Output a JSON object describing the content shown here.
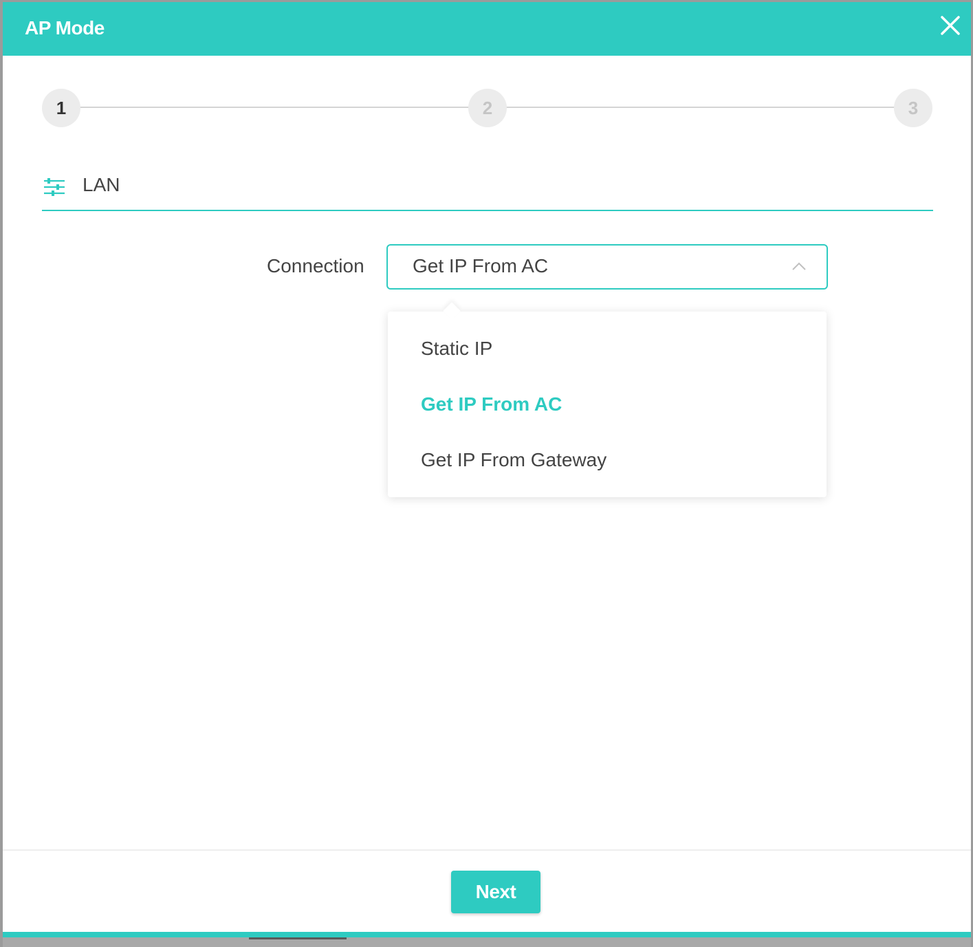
{
  "dialog": {
    "title": "AP Mode",
    "close_icon": "close-icon",
    "accent_color": "#2ecbc1"
  },
  "stepper": {
    "steps": [
      "1",
      "2",
      "3"
    ],
    "active_step": 1
  },
  "section": {
    "icon": "sliders-icon",
    "label": "LAN"
  },
  "form": {
    "connection_label": "Connection",
    "connection_value": "Get IP From AC"
  },
  "dropdown": {
    "options": [
      "Static IP",
      "Get IP From AC",
      "Get IP From Gateway"
    ],
    "selected": "Get IP From AC"
  },
  "footer": {
    "next_label": "Next"
  }
}
